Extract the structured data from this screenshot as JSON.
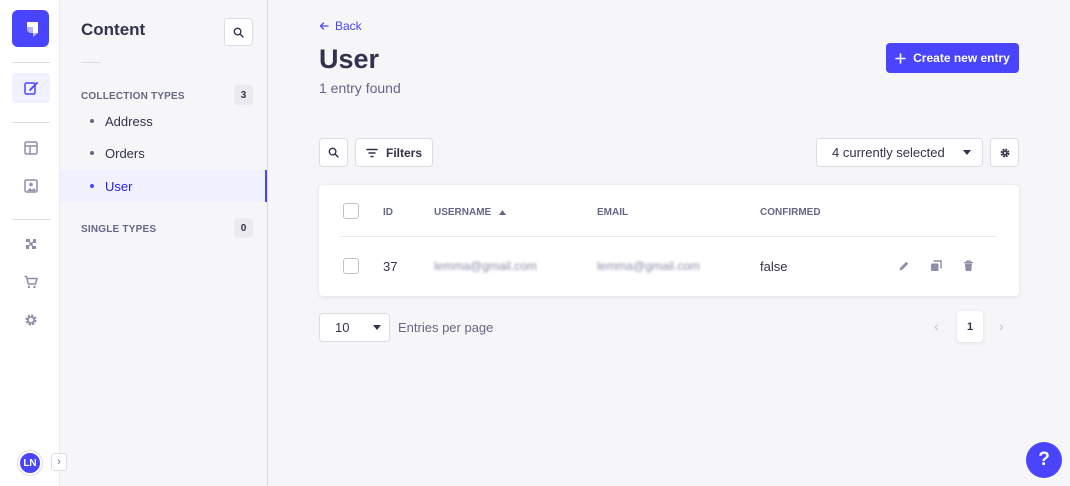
{
  "colors": {
    "primary": "#4945ff",
    "text": "#32324d",
    "muted": "#666687",
    "background": "#f6f6f9"
  },
  "rail": {
    "items": [
      {
        "icon": "content-manager-icon",
        "active": true
      },
      {
        "icon": "content-type-builder-icon"
      },
      {
        "icon": "media-library-icon"
      },
      {
        "icon": "plugins-icon"
      },
      {
        "icon": "marketplace-icon"
      },
      {
        "icon": "settings-icon"
      }
    ],
    "avatar_initials": "LN"
  },
  "sidebar": {
    "title": "Content",
    "collection_types": {
      "header": "COLLECTION TYPES",
      "count": "3",
      "items": [
        {
          "label": "Address"
        },
        {
          "label": "Orders"
        },
        {
          "label": "User",
          "active": true
        }
      ]
    },
    "single_types": {
      "header": "SINGLE TYPES",
      "count": "0"
    }
  },
  "header": {
    "back_label": "Back",
    "title": "User",
    "subtitle": "1 entry found",
    "create_label": "Create new entry"
  },
  "toolbar": {
    "filters_label": "Filters",
    "columns_selected": "4 currently selected"
  },
  "table": {
    "columns": [
      {
        "label": "ID"
      },
      {
        "label": "USERNAME",
        "sorted": "asc"
      },
      {
        "label": "EMAIL"
      },
      {
        "label": "CONFIRMED"
      }
    ],
    "rows": [
      {
        "id": "37",
        "username": "lemma@gmail.com",
        "email": "lemma@gmail.com",
        "confirmed": "false"
      }
    ]
  },
  "pagination": {
    "page_size": "10",
    "page_size_label": "Entries per page",
    "current_page": "1"
  },
  "help_label": "?"
}
